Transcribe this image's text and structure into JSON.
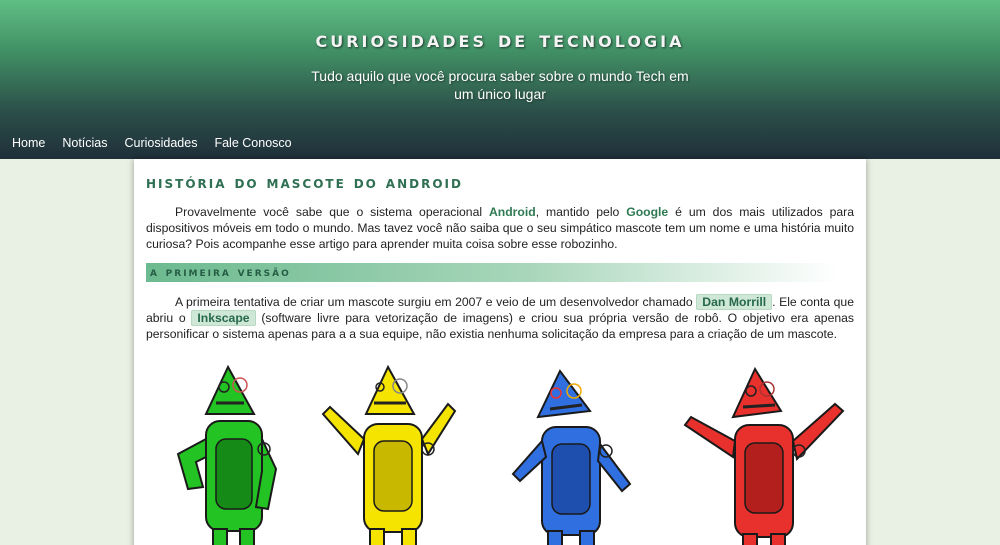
{
  "header": {
    "title": "CURIOSIDADES DE TECNOLOGIA",
    "subtitle": "Tudo aquilo que você procura saber sobre o mundo Tech em um único lugar"
  },
  "nav": {
    "items": [
      "Home",
      "Notícias",
      "Curiosidades",
      "Fale Conosco"
    ]
  },
  "article": {
    "title": "HISTÓRIA DO MASCOTE DO ANDROID",
    "intro": {
      "t1": "Provavelmente você sabe que o sistema operacional ",
      "android": "Android",
      "t2": ", mantido pelo ",
      "google": "Google",
      "t3": " é um dos mais utilizados para dispositivos móveis em todo o mundo. Mas tavez você não saiba que o seu simpático mascote tem um nome e uma história muito curiosa? Pois acompanhe esse artigo para aprender muita coisa sobre esse robozinho."
    },
    "section1": {
      "title": "A PRIMEIRA VERSÃO",
      "t1": "A primeira tentativa de criar um mascote surgiu em 2007 e veio de um desenvolvedor chamado ",
      "person": "Dan Morrill",
      "t2": ". Ele conta que abriu o ",
      "software": "Inkscape",
      "t3": " (software livre para vetorização de imagens) e criou sua própria versão de robô. O objetivo era apenas personificar o sistema apenas para a a sua equipe, não existia nenhuma solicitação da empresa para a criação de um mascote."
    }
  },
  "robots": [
    {
      "color": "#22c322",
      "dark": "#168a16"
    },
    {
      "color": "#f5e400",
      "dark": "#c9b800"
    },
    {
      "color": "#2f6fe0",
      "dark": "#1e4fae"
    },
    {
      "color": "#e8302c",
      "dark": "#b31f1c"
    }
  ]
}
